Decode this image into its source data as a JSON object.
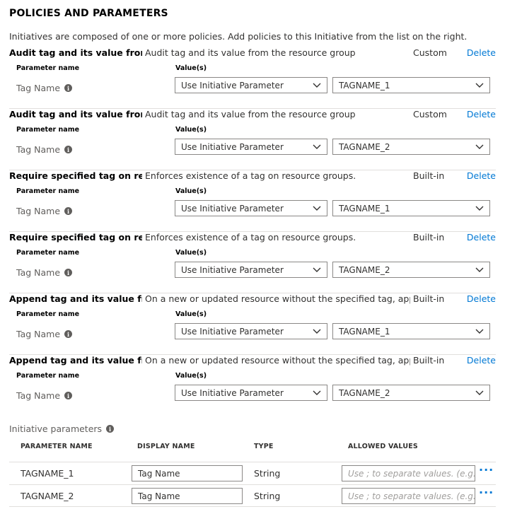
{
  "section_title": "POLICIES AND PARAMETERS",
  "intro": "Initiatives are composed of one or more policies. Add policies to this Initiative from the list on the right.",
  "labels": {
    "parameter_name": "Parameter name",
    "values": "Value(s)",
    "delete": "Delete",
    "tag_name": "Tag Name",
    "use_initiative_parameter": "Use Initiative Parameter"
  },
  "policies": [
    {
      "name": "Audit tag and its value from...",
      "description": "Audit tag and its value from the resource group",
      "type": "Custom",
      "value": "TAGNAME_1"
    },
    {
      "name": "Audit tag and its value from...",
      "description": "Audit tag and its value from the resource group",
      "type": "Custom",
      "value": "TAGNAME_2"
    },
    {
      "name": "Require specified tag on res...",
      "description": "Enforces existence of a tag on resource groups.",
      "type": "Built-in",
      "value": "TAGNAME_1"
    },
    {
      "name": "Require specified tag on res...",
      "description": "Enforces existence of a tag on resource groups.",
      "type": "Built-in",
      "value": "TAGNAME_2"
    },
    {
      "name": "Append tag and its value fro...",
      "description": "On a new or updated resource without the specified tag, appen...",
      "type": "Built-in",
      "value": "TAGNAME_1"
    },
    {
      "name": "Append tag and its value fro...",
      "description": "On a new or updated resource without the specified tag, appen...",
      "type": "Built-in",
      "value": "TAGNAME_2"
    }
  ],
  "initiative_parameters": {
    "label": "Initiative parameters",
    "columns": [
      "PARAMETER NAME",
      "DISPLAY NAME",
      "TYPE",
      "ALLOWED VALUES"
    ],
    "allowed_placeholder": "Use ; to separate values. (e.g. L...",
    "rows": [
      {
        "name": "TAGNAME_1",
        "display": "Tag Name",
        "type": "String"
      },
      {
        "name": "TAGNAME_2",
        "display": "Tag Name",
        "type": "String"
      }
    ]
  },
  "colors": {
    "link": "#0078d4",
    "border": "#8a8886",
    "divider": "#e1dfdd"
  }
}
